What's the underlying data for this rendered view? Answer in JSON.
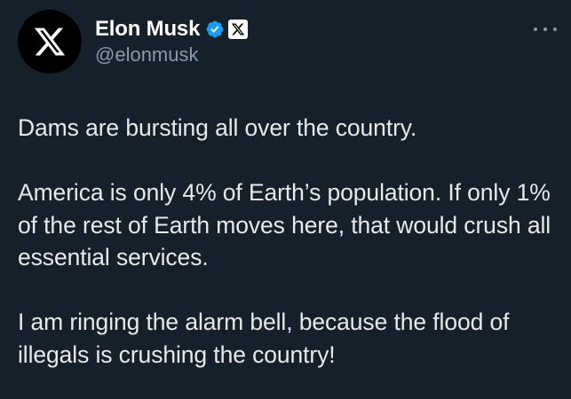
{
  "author": {
    "avatar_icon": "x-logo-icon",
    "display_name": "Elon Musk",
    "handle": "@elonmusk",
    "verified_icon": "verified-badge-icon",
    "verified_color": "#1d9bf0",
    "affiliation_icon": "x-logo-icon"
  },
  "menu": {
    "icon": "more-options-icon"
  },
  "tweet": {
    "paragraphs": [
      "Dams are bursting all over the country.",
      "America is only 4% of Earth’s population. If only 1% of the rest of Earth moves here, that would crush all essential services.",
      "I am ringing the alarm bell, because the flood of illegals is crushing the country!"
    ]
  },
  "theme": {
    "background": "#15202b",
    "text": "#e7e9ea",
    "secondary_text": "#8b98a5"
  }
}
